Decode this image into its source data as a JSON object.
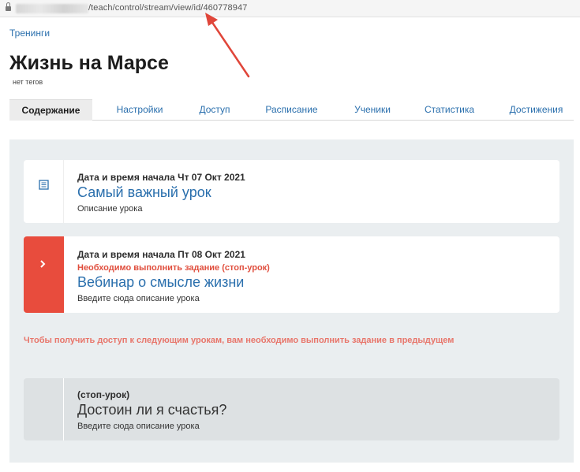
{
  "browser": {
    "url_visible": "/teach/control/stream/view/id/460778947"
  },
  "breadcrumb": {
    "label": "Тренинги"
  },
  "page": {
    "title": "Жизнь на Марсе",
    "tags": "нет тегов"
  },
  "tabs": [
    {
      "label": "Содержание",
      "active": true
    },
    {
      "label": "Настройки",
      "active": false
    },
    {
      "label": "Доступ",
      "active": false
    },
    {
      "label": "Расписание",
      "active": false
    },
    {
      "label": "Ученики",
      "active": false
    },
    {
      "label": "Статистика",
      "active": false
    },
    {
      "label": "Достижения",
      "active": false
    }
  ],
  "lessons": [
    {
      "meta": "Дата и время начала Чт 07 Окт 2021",
      "name": "Самый важный урок",
      "description": "Описание урока",
      "icon": "list-icon"
    },
    {
      "meta": "Дата и время начала Пт 08 Окт 2021",
      "warning": "Необходимо выполнить задание (стоп-урок)",
      "name": "Вебинар о смысле жизни",
      "description": "Введите сюда описание урока",
      "icon": "chevron-right-icon",
      "accent": "#e84c3d"
    },
    {
      "meta": "(стоп-урок)",
      "name": "Достоин ли я счастья?",
      "description": "Введите сюда описание урока"
    }
  ],
  "notice": "Чтобы получить доступ к следующим урокам, вам необходимо выполнить задание в предыдущем",
  "colors": {
    "link": "#2a6fad",
    "accent": "#e84c3d",
    "warning": "#e04e3d",
    "annotation_arrow": "#e0463a"
  }
}
